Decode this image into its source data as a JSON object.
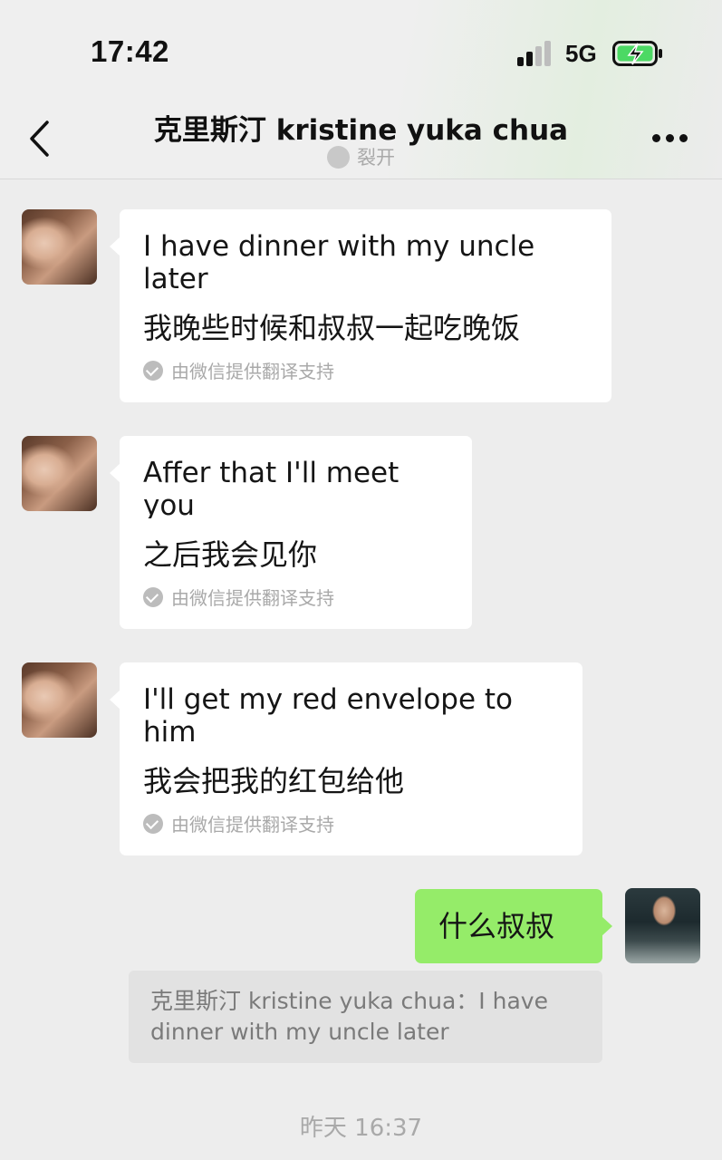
{
  "status_bar": {
    "time": "17:42",
    "network": "5G",
    "battery_state": "charging"
  },
  "nav": {
    "title": "克里斯汀 kristine yuka chua",
    "subtitle": "裂开",
    "back_icon": "chevron-left-icon",
    "more_icon": "more-dots-icon"
  },
  "messages": [
    {
      "sender": "contact",
      "text": "I have dinner with my uncle later",
      "translation": "我晚些时候和叔叔一起吃晚饭",
      "translation_credit": "由微信提供翻译支持"
    },
    {
      "sender": "contact",
      "text": "Affer that I'll meet you",
      "translation": "之后我会见你",
      "translation_credit": "由微信提供翻译支持"
    },
    {
      "sender": "contact",
      "text": "I'll get my red envelope to him",
      "translation": "我会把我的红包给他",
      "translation_credit": "由微信提供翻译支持"
    },
    {
      "sender": "me",
      "text": "什么叔叔",
      "quote": "克里斯汀 kristine yuka chua：I have dinner with my uncle later"
    }
  ],
  "timestamp": "昨天 16:37",
  "colors": {
    "my_bubble": "#95ec69",
    "their_bubble": "#ffffff",
    "chat_background": "#ededed"
  }
}
